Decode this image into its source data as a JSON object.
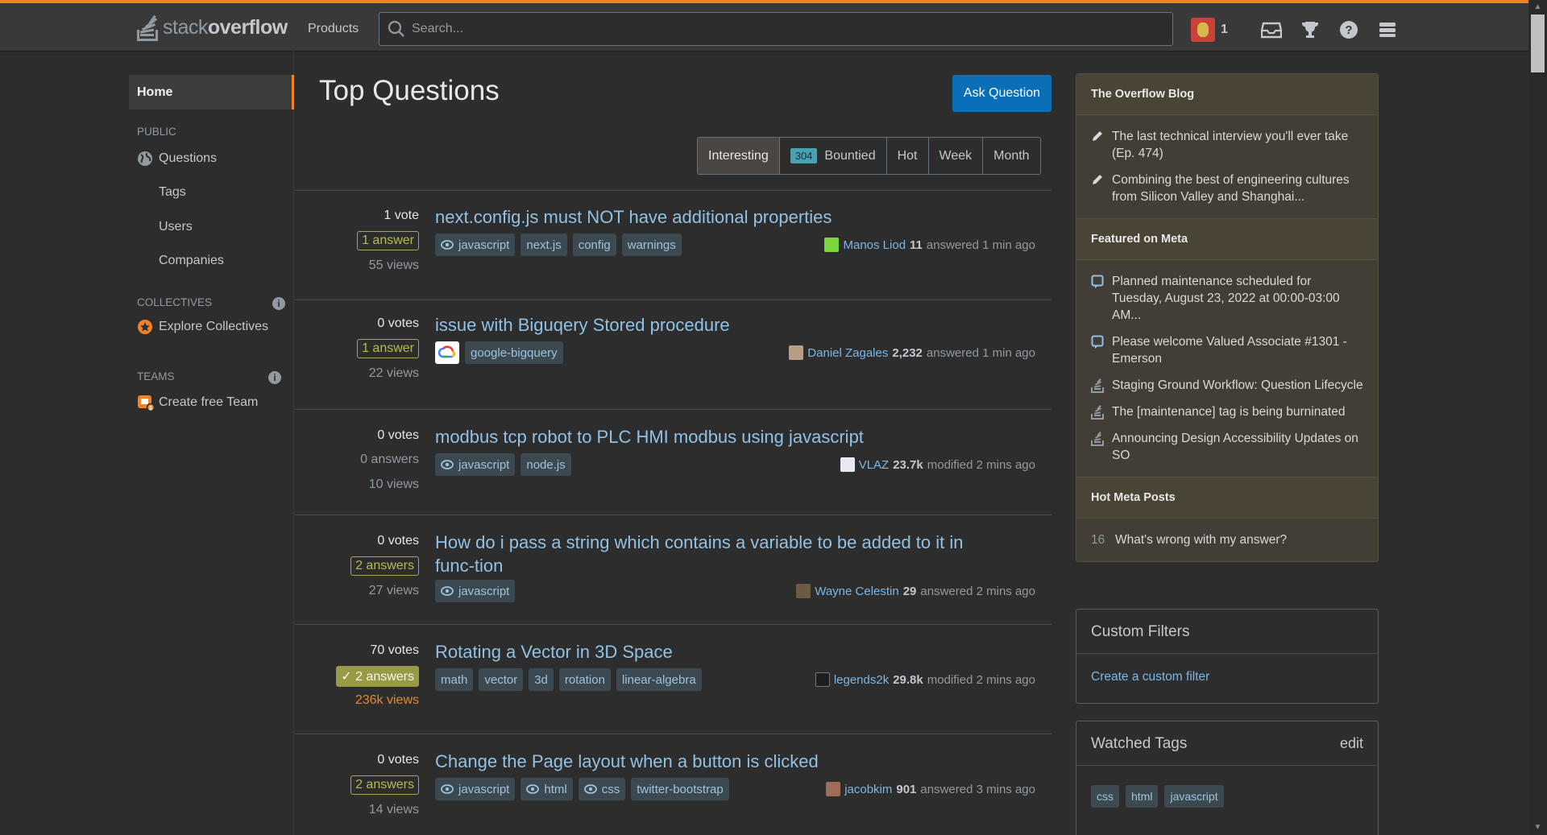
{
  "header": {
    "logo_light": "stack",
    "logo_bold": "overflow",
    "products_label": "Products",
    "search_placeholder": "Search...",
    "reputation": "1"
  },
  "sidebar": {
    "home": "Home",
    "public_label": "PUBLIC",
    "questions": "Questions",
    "tags": "Tags",
    "users": "Users",
    "companies": "Companies",
    "collectives_label": "COLLECTIVES",
    "explore_collectives": "Explore Collectives",
    "teams_label": "TEAMS",
    "create_team": "Create free Team"
  },
  "main": {
    "title": "Top Questions",
    "ask_button": "Ask Question",
    "filters": {
      "interesting": "Interesting",
      "bounty_count": "304",
      "bountied": "Bountied",
      "hot": "Hot",
      "week": "Week",
      "month": "Month"
    },
    "questions": [
      {
        "votes": "1 vote",
        "answers": "1 answer",
        "views": "55 views",
        "title": "next.config.js must NOT have additional properties",
        "tags": [
          "javascript",
          "next.js",
          "config",
          "warnings"
        ],
        "user": "Manos Liod",
        "rep": "11",
        "action": "answered 1 min ago"
      },
      {
        "votes": "0 votes",
        "answers": "1 answer",
        "views": "22 views",
        "title": "issue with Biguqery Stored procedure",
        "tags": [
          "google-bigquery"
        ],
        "user": "Daniel Zagales",
        "rep": "2,232",
        "action": "answered 1 min ago"
      },
      {
        "votes": "0 votes",
        "answers": "0 answers",
        "views": "10 views",
        "title": "modbus tcp robot to PLC HMI modbus using javascript",
        "tags": [
          "javascript",
          "node.js"
        ],
        "user": "VLAZ",
        "rep": "23.7k",
        "action": "modified 2 mins ago"
      },
      {
        "votes": "0 votes",
        "answers": "2 answers",
        "views": "27 views",
        "title": "How do i pass a string which contains a variable to be added to it in func-tion",
        "tags": [
          "javascript"
        ],
        "user": "Wayne Celestin",
        "rep": "29",
        "action": "answered 2 mins ago"
      },
      {
        "votes": "70 votes",
        "answers": "2 answers",
        "views": "236k views",
        "title": "Rotating a Vector in 3D Space",
        "tags": [
          "math",
          "vector",
          "3d",
          "rotation",
          "linear-algebra"
        ],
        "user": "legends2k",
        "rep": "29.8k",
        "action": "modified 2 mins ago"
      },
      {
        "votes": "0 votes",
        "answers": "2 answers",
        "views": "14 views",
        "title": "Change the Page layout when a button is clicked",
        "tags": [
          "javascript",
          "html",
          "css",
          "twitter-bootstrap"
        ],
        "user": "jacobkim",
        "rep": "901",
        "action": "answered 3 mins ago"
      }
    ]
  },
  "right": {
    "blog_title": "The Overflow Blog",
    "blog_items": [
      "The last technical interview you'll ever take (Ep. 474)",
      "Combining the best of engineering cultures from Silicon Valley and Shanghai..."
    ],
    "meta_title": "Featured on Meta",
    "meta_items": [
      "Planned maintenance scheduled for Tuesday, August 23, 2022 at 00:00-03:00 AM...",
      "Please welcome Valued Associate #1301 - Emerson",
      "Staging Ground Workflow: Question Lifecycle",
      "The [maintenance] tag is being burninated",
      "Announcing Design Accessibility Updates on SO"
    ],
    "hot_title": "Hot Meta Posts",
    "hot_count": "16",
    "hot_item": "What's wrong with my answer?",
    "custom_filters_title": "Custom Filters",
    "custom_filter_link": "Create a custom filter",
    "watched_title": "Watched Tags",
    "watched_edit": "edit",
    "watched_tags": [
      "css",
      "html",
      "javascript"
    ]
  },
  "colors": {
    "accent": "#f48225",
    "link": "#91c1e4",
    "ask_button": "#0a6fb8",
    "tag_bg": "#3d4951",
    "answer_accepted": "#999a46"
  }
}
